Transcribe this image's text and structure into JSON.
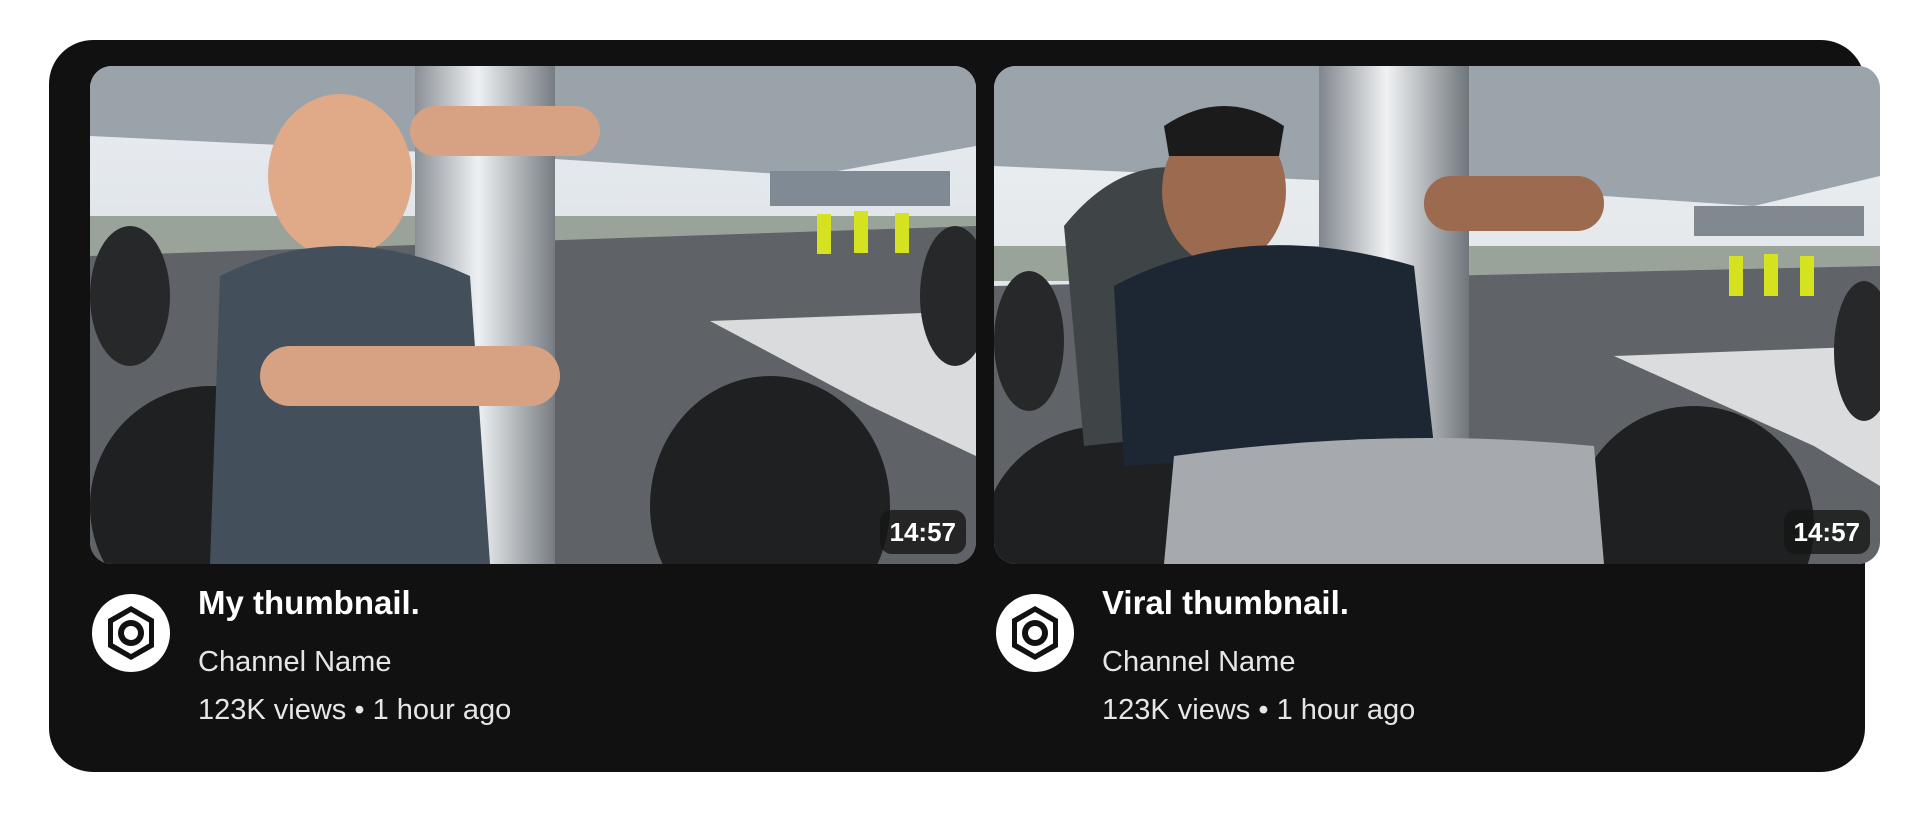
{
  "cards": [
    {
      "duration": "14:57",
      "title": "My thumbnail.",
      "channel": "Channel Name",
      "stats": "123K views • 1 hour ago",
      "avatar_icon": "hexagon-nut-icon"
    },
    {
      "duration": "14:57",
      "title": "Viral thumbnail.",
      "channel": "Channel Name",
      "stats": "123K views • 1 hour ago",
      "avatar_icon": "hexagon-nut-icon"
    }
  ],
  "colors": {
    "panel": "#111111",
    "page": "#ffffff",
    "text_primary": "#ffffff",
    "text_secondary": "#e6e6e6"
  }
}
